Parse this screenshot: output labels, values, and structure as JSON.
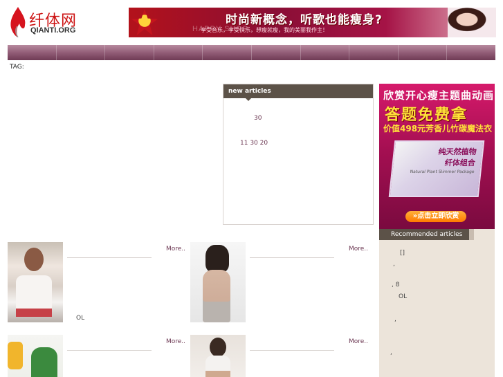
{
  "logo": {
    "cn": "纤体网",
    "en": "QIANTI.ORG"
  },
  "top_banner": {
    "headline": "时尚新概念，听歌也能瘦身?",
    "happy_word": "HAPPY SHOP",
    "sub": "享受音乐，享受快乐，想瘦就瘦，我的美丽我作主！"
  },
  "nav": {
    "items": [
      "",
      "",
      "",
      "",
      "",
      "",
      "",
      "",
      "",
      ""
    ]
  },
  "tag": {
    "label": "TAG:"
  },
  "new_articles": {
    "title": "new articles",
    "rows": [
      {
        "text": "30"
      },
      {
        "text": "11   30   20"
      }
    ]
  },
  "side_ad": {
    "line1": "欣赏开心瘦主题曲动画",
    "line2": "答题免费拿",
    "line3": "价值498元芳香儿竹碳魔法衣",
    "box_title1": "纯天然植物",
    "box_title2": "纤体组合",
    "box_tiny": "Natural Plant Slimmer Package",
    "button": "»点击立即欣赏"
  },
  "recommended": {
    "title": "Recommended articles",
    "marks": [
      "[]",
      ",",
      ",   8",
      "OL",
      ",",
      ","
    ]
  },
  "cards": [
    {
      "more": "More..",
      "ol": "OL"
    },
    {
      "more": "More..",
      "ol": ""
    },
    {
      "more": "More..",
      "ol": ""
    },
    {
      "more": "More..",
      "ol": ""
    }
  ]
}
